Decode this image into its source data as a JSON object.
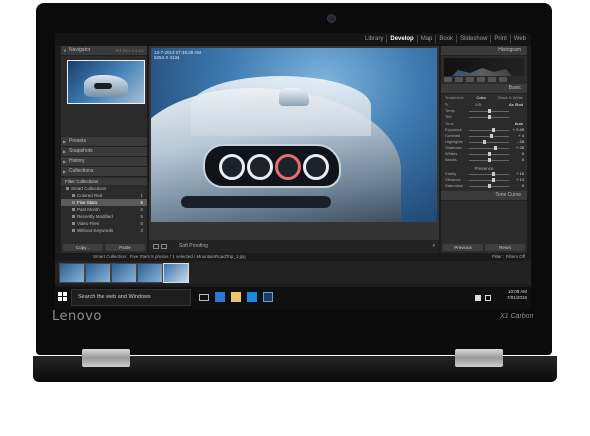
{
  "device": {
    "brand": "Lenovo",
    "model": "X1 Carbon"
  },
  "modules": [
    "Library",
    "Develop",
    "Map",
    "Book",
    "Slideshow",
    "Print",
    "Web"
  ],
  "active_module": "Develop",
  "left_panel": {
    "navigator_label": "Navigator",
    "zoom_options": "FIT  FILL  1:1  3:1",
    "sections": [
      "Presets",
      "Snapshots",
      "History",
      "Collections"
    ],
    "collections": {
      "filter_label": "Filter Collections",
      "group": "Smart Collections",
      "items": [
        {
          "label": "Colored Red",
          "count": "1"
        },
        {
          "label": "Five Stars",
          "count": "5"
        },
        {
          "label": "Past Month",
          "count": "0"
        },
        {
          "label": "Recently Modified",
          "count": "5"
        },
        {
          "label": "Video Files",
          "count": "0"
        },
        {
          "label": "Without Keywords",
          "count": "3"
        }
      ]
    },
    "copy_button": "Copy...",
    "paste_button": "Paste"
  },
  "photo": {
    "info_line1": "13-7-2013 07:45:28 AM",
    "info_line2": "6254 X 4134"
  },
  "center_toolbar": {
    "soft_proofing": "Soft Proofing"
  },
  "right_panel": {
    "histogram_label": "Histogram",
    "basic_label": "Basic",
    "treatment_label": "Treatment:",
    "treatment_options": [
      "Color",
      "Black & White"
    ],
    "wb_label": "WB:",
    "wb_value": "As Shot",
    "tone_label": "Tone",
    "tone_auto": "Auto",
    "presence_label": "Presence",
    "sliders": [
      {
        "label": "Temp",
        "value": "",
        "pos": 0.5,
        "group": "wb"
      },
      {
        "label": "Tint",
        "value": "",
        "pos": 0.5,
        "group": "wb"
      },
      {
        "label": "Exposure",
        "value": "+ 0.45",
        "pos": 0.6,
        "group": "tone"
      },
      {
        "label": "Contrast",
        "value": "+ 4",
        "pos": 0.55,
        "group": "tone"
      },
      {
        "label": "Highlights",
        "value": "- 28",
        "pos": 0.38,
        "group": "tone"
      },
      {
        "label": "Shadows",
        "value": "+ 28",
        "pos": 0.65,
        "group": "tone"
      },
      {
        "label": "Whites",
        "value": "0",
        "pos": 0.5,
        "group": "tone"
      },
      {
        "label": "Blacks",
        "value": "0",
        "pos": 0.5,
        "group": "tone"
      },
      {
        "label": "Clarity",
        "value": "+ 16",
        "pos": 0.62,
        "group": "presence"
      },
      {
        "label": "Vibrance",
        "value": "+ 14",
        "pos": 0.6,
        "group": "presence"
      },
      {
        "label": "Saturation",
        "value": "0",
        "pos": 0.5,
        "group": "presence"
      }
    ],
    "tone_curve_label": "Tone Curve",
    "previous_button": "Previous",
    "reset_button": "Reset"
  },
  "filmstrip": {
    "path": "Smart Collection : Five Stars     5 photos / 1 selected / MountainRoadTrip_1.jpg",
    "filter_label": "Filter :",
    "filter_value": "Filters Off",
    "thumb_count": 5,
    "selected_index": 4
  },
  "taskbar": {
    "search_placeholder": "Search the web and Windows",
    "time": "10:08 AM",
    "date": "7/01/2015"
  },
  "colors": {
    "lr_panel": "#2b2b2b",
    "lr_header": "#3a3a3a",
    "photo_bg": "#3d7ab0",
    "lr_icon": "#1b3a5c"
  }
}
